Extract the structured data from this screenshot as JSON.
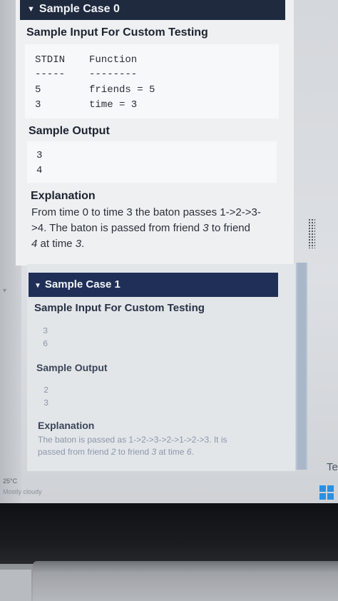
{
  "case0": {
    "header": "Sample Case 0",
    "input_title": "Sample Input For Custom Testing",
    "stdin_header": "STDIN",
    "function_header": "Function",
    "stdin_rule": "-----",
    "function_rule": "--------",
    "rows": [
      {
        "stdin": "5",
        "function": "friends = 5"
      },
      {
        "stdin": "3",
        "function": "time = 3"
      }
    ],
    "output_title": "Sample Output",
    "output": [
      "3",
      "4"
    ],
    "explanation_title": "Explanation",
    "explanation_line1": "From time 0 to time 3 the baton passes 1->2->3-",
    "explanation_line2_a": ">4. The baton is passed from friend ",
    "explanation_line2_em": "3",
    "explanation_line2_b": " to friend",
    "explanation_line3_em1": "4",
    "explanation_line3_a": " at time ",
    "explanation_line3_em2": "3",
    "explanation_line3_b": "."
  },
  "case1": {
    "header": "Sample Case 1",
    "input_title": "Sample Input For Custom Testing",
    "input": [
      "3",
      "6"
    ],
    "output_title": "Sample Output",
    "output": [
      "2",
      "3"
    ],
    "explanation_title": "Explanation",
    "explanation_line1": "The baton is passed as 1->2->3->2->1->2->3. It is",
    "explanation_line2_a": "passed from friend ",
    "explanation_line2_em1": "2",
    "explanation_line2_b": " to friend ",
    "explanation_line2_em2": "3",
    "explanation_line2_c": " at time ",
    "explanation_line2_em3": "6",
    "explanation_line2_d": "."
  },
  "taskbar": {
    "temperature": "25°C",
    "weather": "Mostly cloudy",
    "side_text": "Te"
  },
  "icons": {
    "collapse": "triangle-down-icon",
    "start": "windows-start-icon"
  }
}
